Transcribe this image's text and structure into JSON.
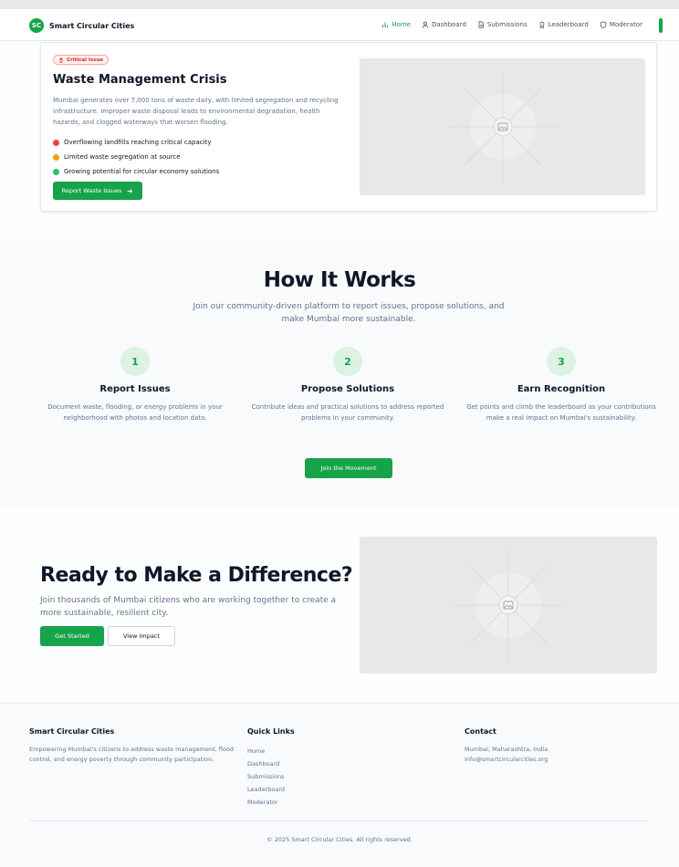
{
  "nav": {
    "brand_initials": "SC",
    "brand_name": "Smart Circular Cities",
    "items": [
      {
        "label": "Home",
        "icon": "chart-icon"
      },
      {
        "label": "Dashboard",
        "icon": "user-icon"
      },
      {
        "label": "Submissions",
        "icon": "document-icon"
      },
      {
        "label": "Leaderboard",
        "icon": "award-icon"
      },
      {
        "label": "Moderator",
        "icon": "shield-icon"
      }
    ],
    "active": "Home"
  },
  "crisis": {
    "badge": "Critical Issue",
    "title": "Waste Management Crisis",
    "description": "Mumbai generates over 7,000 tons of waste daily, with limited segregation and recycling infrastructure. Improper waste disposal leads to environmental degradation, health hazards, and clogged waterways that worsen flooding.",
    "bullets": [
      {
        "text": "Overflowing landfills reaching critical capacity",
        "color": "#ef4444"
      },
      {
        "text": "Limited waste segregation at source",
        "color": "#f59e0b"
      },
      {
        "text": "Growing potential for circular economy solutions",
        "color": "#22c55e"
      }
    ],
    "button": "Report Waste Issues"
  },
  "how": {
    "title": "How It Works",
    "subtitle": "Join our community-driven platform to report issues, propose solutions, and make Mumbai more sustainable.",
    "steps": [
      {
        "num": "1",
        "title": "Report Issues",
        "desc": "Document waste, flooding, or energy problems in your neighborhood with photos and location data."
      },
      {
        "num": "2",
        "title": "Propose Solutions",
        "desc": "Contribute ideas and practical solutions to address reported problems in your community."
      },
      {
        "num": "3",
        "title": "Earn Recognition",
        "desc": "Get points and climb the leaderboard as your contributions make a real impact on Mumbai's sustainability."
      }
    ],
    "button": "Join the Movement"
  },
  "ready": {
    "title": "Ready to Make a Difference?",
    "description": "Join thousands of Mumbai citizens who are working together to create a more sustainable, resilient city.",
    "primary_button": "Get Started",
    "secondary_button": "View Impact"
  },
  "footer": {
    "about_title": "Smart Circular Cities",
    "about_text": "Empowering Mumbai's citizens to address waste management, flood control, and energy poverty through community participation.",
    "links_title": "Quick Links",
    "links": [
      "Home",
      "Dashboard",
      "Submissions",
      "Leaderboard",
      "Moderator"
    ],
    "contact_title": "Contact",
    "contact_location": "Mumbai, Maharashtra, India",
    "contact_email": "info@smartcircularcities.org",
    "copyright": "© 2025 Smart Circular Cities. All rights reserved."
  },
  "colors": {
    "accent": "#16a34a",
    "critical": "#dc2626",
    "placeholder": "#e8e8e8"
  }
}
